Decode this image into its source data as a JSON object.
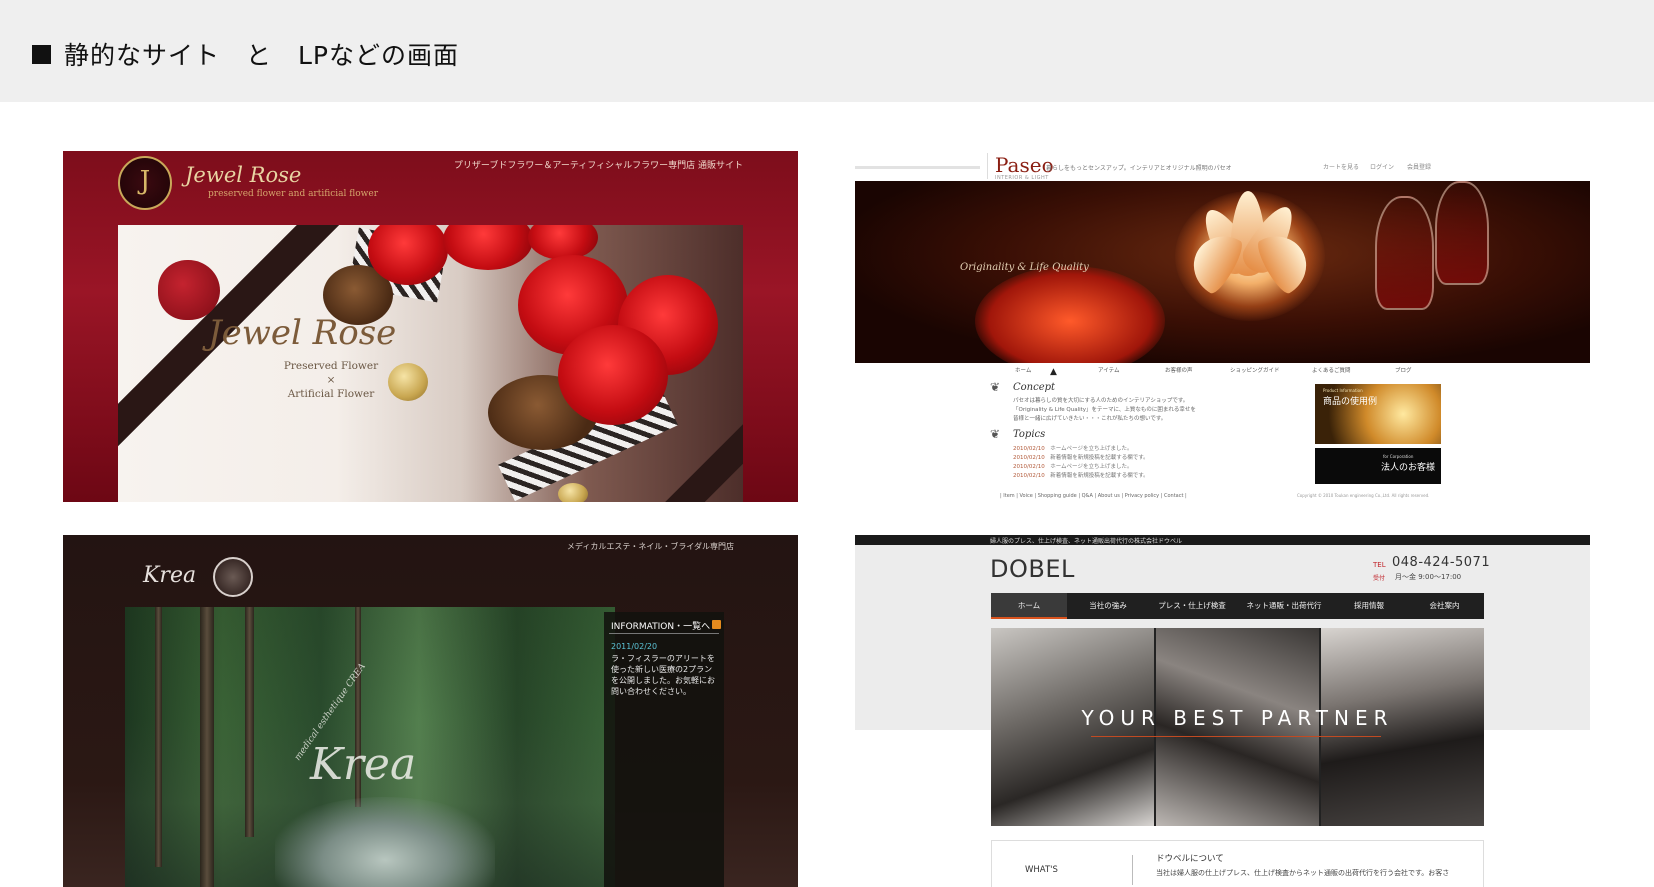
{
  "header": {
    "title": "静的なサイト　と　LPなどの画面"
  },
  "jewel_rose": {
    "topline": "プリザーブドフラワー＆アーティフィシャルフラワー専門店 通販サイト",
    "logo_letter": "J",
    "logo_text": "Jewel Rose",
    "logo_sub": "preserved flower and artificial flower",
    "hero_title": "Jewel Rose",
    "hero_sub": [
      "Preserved Flower",
      "×",
      "Artificial Flower"
    ]
  },
  "paseo": {
    "logo": "Paseo",
    "logo_sub": "INTERIOR & LIGHT",
    "description": "暮らしをもっとセンスアップ。インテリアとオリジナル照明のパセオ",
    "util_links": [
      "カートを見る",
      "ログイン",
      "会員登録"
    ],
    "tagline": "Originality & Life Quality",
    "nav": [
      "ホーム",
      "アイテム",
      "お客様の声",
      "ショッピングガイド",
      "よくあるご質問",
      "ブログ"
    ],
    "concept_heading": "Concept",
    "concept_text": [
      "パセオは暮らしの質を大切にする人のためのインテリアショップです。",
      "「Originality & Life Quality」をテーマに、上質なものに囲まれる幸せを",
      "皆様と一緒に広げていきたい・・・これが私たちの想いです。"
    ],
    "topics_heading": "Topics",
    "topics": [
      {
        "date": "2010/02/10",
        "text": "ホームページを立ち上げました。"
      },
      {
        "date": "2010/02/10",
        "text": "新着情報を新規投稿を記載する欄です。"
      },
      {
        "date": "2010/02/10",
        "text": "ホームページを立ち上げました。"
      },
      {
        "date": "2010/02/10",
        "text": "新着情報を新規投稿を記載する欄です。"
      }
    ],
    "banner1_small": "Product Information",
    "banner1_text": "商品の使用例",
    "banner2_small": "for Corporation",
    "banner2_text": "法人のお客様",
    "footer_links": "|  Item  |  Voice  |  Shopping guide  |  Q&A  |  About us  |  Privacy policy  |  Contact  |",
    "copyright": "Copyright © 2010 Toukan engineering Co.,Ltd. All rights reserved."
  },
  "krea": {
    "topline": "メディカルエステ・ネイル・ブライダル専門店",
    "logo": "Krea",
    "watermark": "Krea",
    "watermark_small": "medical esthetique CREA",
    "info_heading": "INFORMATION・一覧へ",
    "info_date": "2011/02/20",
    "info_body": "ラ・フィスラーのアリートを使った新しい医療の2プランを公開しました。お気軽にお問い合わせください。"
  },
  "dobel": {
    "topline": "婦人服のプレス、仕上げ検査、ネット通販出荷代行の株式会社ドウベル",
    "logo": "DOBEL",
    "tel_label": "TEL",
    "tel": "048-424-5071",
    "hours_label": "受付",
    "hours": "月〜金 9:00〜17:00",
    "nav": [
      "ホーム",
      "当社の強み",
      "プレス・仕上げ検査",
      "ネット通販・出荷代行",
      "採用情報",
      "会社案内"
    ],
    "hero_text": "YOUR BEST PARTNER",
    "whats": "WHAT'S",
    "about_heading": "ドウベルについて",
    "about_text": "当社は婦人服の仕上げプレス、仕上げ検査からネット通販の出荷代行を行う会社です。お客さ"
  },
  "colors": {
    "jewel_red": "#8a1020",
    "paseo_brown": "#3a0f05",
    "krea_dark": "#231412",
    "dobel_nav": "#202020",
    "dobel_accent": "#d9531e"
  }
}
